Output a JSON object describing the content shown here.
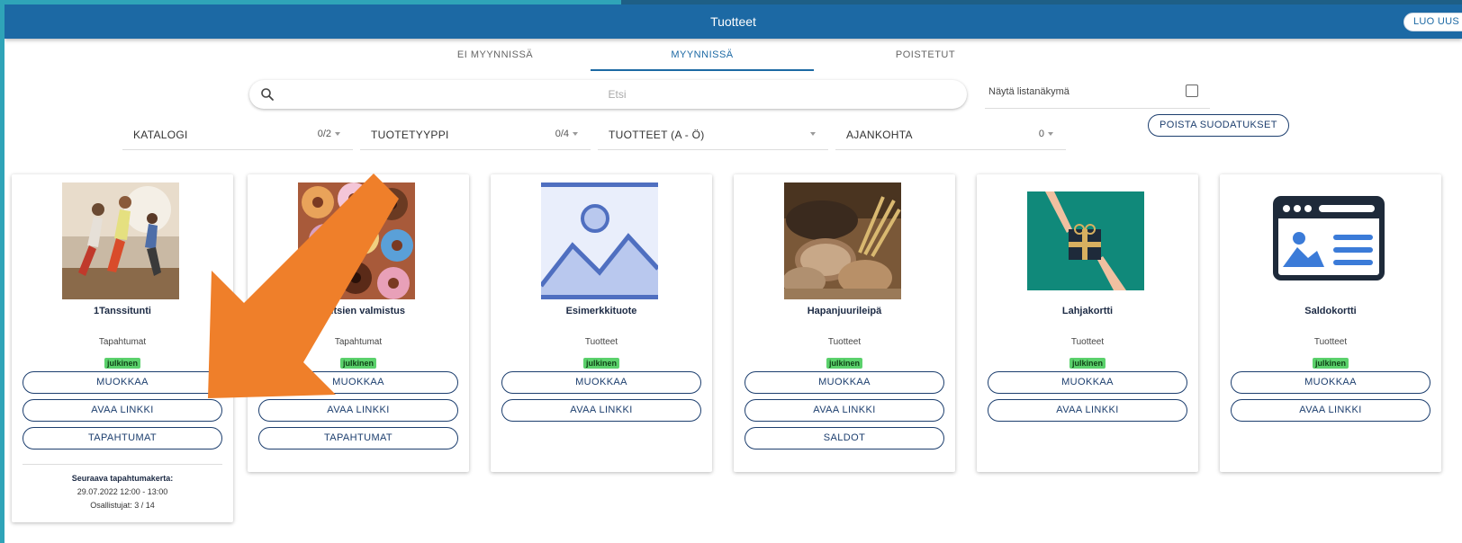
{
  "header": {
    "title": "Tuotteet",
    "create_label": "LUO UUS"
  },
  "tabs": [
    {
      "label": "EI MYYNNISSÄ"
    },
    {
      "label": "MYYNNISSÄ",
      "active": true
    },
    {
      "label": "POISTETUT"
    }
  ],
  "search": {
    "placeholder": "Etsi"
  },
  "list_view": {
    "label": "Näytä listanäkymä",
    "checked": false
  },
  "filters": [
    {
      "label": "KATALOGI",
      "count": "0/2"
    },
    {
      "label": "TUOTETYYPPI",
      "count": "0/4"
    },
    {
      "label": "TUOTTEET (A - Ö)",
      "count": ""
    },
    {
      "label": "AJANKOHTA",
      "count": "0"
    }
  ],
  "clear_filters_label": "POISTA SUODATUKSET",
  "products": [
    {
      "name": "1Tanssitunti",
      "type": "Tapahtumat",
      "status": "julkinen",
      "buttons": [
        "MUOKKAA",
        "AVAA LINKKI",
        "TAPAHTUMAT"
      ],
      "next_event": {
        "title": "Seuraava tapahtumakerta:",
        "time": "29.07.2022 12:00 - 13:00",
        "participants": "Osallistujat: 3 / 14"
      }
    },
    {
      "name": "Donitsien valmistus",
      "type": "Tapahtumat",
      "status": "julkinen",
      "buttons": [
        "MUOKKAA",
        "AVAA LINKKI",
        "TAPAHTUMAT"
      ]
    },
    {
      "name": "Esimerkkituote",
      "type": "Tuotteet",
      "status": "julkinen",
      "buttons": [
        "MUOKKAA",
        "AVAA LINKKI"
      ]
    },
    {
      "name": "Hapanjuurileipä",
      "type": "Tuotteet",
      "status": "julkinen",
      "buttons": [
        "MUOKKAA",
        "AVAA LINKKI",
        "SALDOT"
      ]
    },
    {
      "name": "Lahjakortti",
      "type": "Tuotteet",
      "status": "julkinen",
      "buttons": [
        "MUOKKAA",
        "AVAA LINKKI"
      ]
    },
    {
      "name": "Saldokortti",
      "type": "Tuotteet",
      "status": "julkinen",
      "buttons": [
        "MUOKKAA",
        "AVAA LINKKI"
      ]
    }
  ],
  "colors": {
    "header": "#1c69a4",
    "accent": "#1c3e6e",
    "badge": "#5bd16c",
    "arrow": "#ef7f2a"
  }
}
